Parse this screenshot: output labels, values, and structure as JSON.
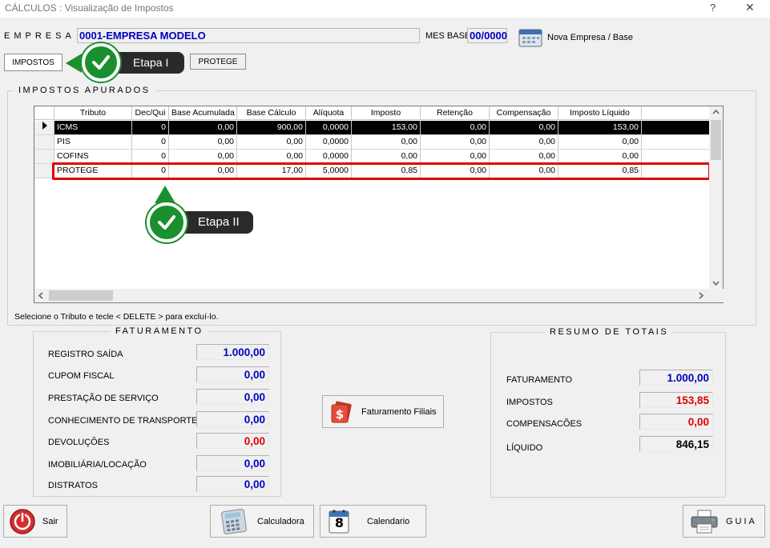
{
  "window": {
    "title": "CÁLCULOS : Visualização de Impostos",
    "help_glyph": "?",
    "close_glyph": "✕"
  },
  "header": {
    "empresa_label": "EMPRESA",
    "empresa_value": "0001-EMPRESA MODELO",
    "mes_base_label": "MES BASE",
    "mes_base_value": "00/0000",
    "nova_empresa_label": "Nova Empresa / Base"
  },
  "tabs": [
    {
      "label": "IMPOSTOS",
      "active": true
    },
    {
      "label": "PROTEGE",
      "active": false
    }
  ],
  "annotations": {
    "step1": "Etapa I",
    "step2": "Etapa II"
  },
  "impostos": {
    "title": "IMPOSTOS APURADOS",
    "columns": [
      "Tributo",
      "Dec/Qui",
      "Base Acumulada",
      "Base Cálculo",
      "Alíquota",
      "Imposto",
      "Retenção",
      "Compensação",
      "Imposto Líquido"
    ],
    "rows": [
      [
        "ICMS",
        "0",
        "0,00",
        "900,00",
        "0,0000",
        "153,00",
        "0,00",
        "0,00",
        "153,00"
      ],
      [
        "PIS",
        "0",
        "0,00",
        "0,00",
        "0,0000",
        "0,00",
        "0,00",
        "0,00",
        "0,00"
      ],
      [
        "COFINS",
        "0",
        "0,00",
        "0,00",
        "0,0000",
        "0,00",
        "0,00",
        "0,00",
        "0,00"
      ],
      [
        "PROTEGE",
        "0",
        "0,00",
        "17,00",
        "5,0000",
        "0,85",
        "0,00",
        "0,00",
        "0,85"
      ]
    ],
    "hint": "Selecione o Tributo e tecle < DELETE > para excluí-lo."
  },
  "faturamento": {
    "title": "FATURAMENTO",
    "items": [
      {
        "label": "REGISTRO SAÍDA",
        "value": "1.000,00",
        "color": "#0000c0"
      },
      {
        "label": "CUPOM FISCAL",
        "value": "0,00",
        "color": "#0000c0"
      },
      {
        "label": "PRESTAÇÃO DE SERVIÇO",
        "value": "0,00",
        "color": "#0000c0"
      },
      {
        "label": "CONHECIMENTO DE TRANSPORTE",
        "value": "0,00",
        "color": "#0000c0"
      },
      {
        "label": "DEVOLUÇÕES",
        "value": "0,00",
        "color": "#e00000"
      },
      {
        "label": "IMOBILIÁRIA/LOCAÇÃO",
        "value": "0,00",
        "color": "#0000c0"
      },
      {
        "label": "DISTRATOS",
        "value": "0,00",
        "color": "#0000c0"
      }
    ]
  },
  "faturamento_filiais_label": "Faturamento Filiais",
  "resumo": {
    "title": "RESUMO DE TOTAIS",
    "items": [
      {
        "label": "FATURAMENTO",
        "value": "1.000,00",
        "color": "#0000c0"
      },
      {
        "label": "IMPOSTOS",
        "value": "153,85",
        "color": "#e00000"
      },
      {
        "label": "COMPENSACÕES",
        "value": "0,00",
        "color": "#e00000"
      },
      {
        "label": "LÍQUIDO",
        "value": "846,15",
        "color": "#000000"
      }
    ]
  },
  "footer": {
    "sair": "Sair",
    "calculadora": "Calculadora",
    "calendario": "Calendario",
    "calendar_day": "8",
    "guia": "GUIA"
  }
}
